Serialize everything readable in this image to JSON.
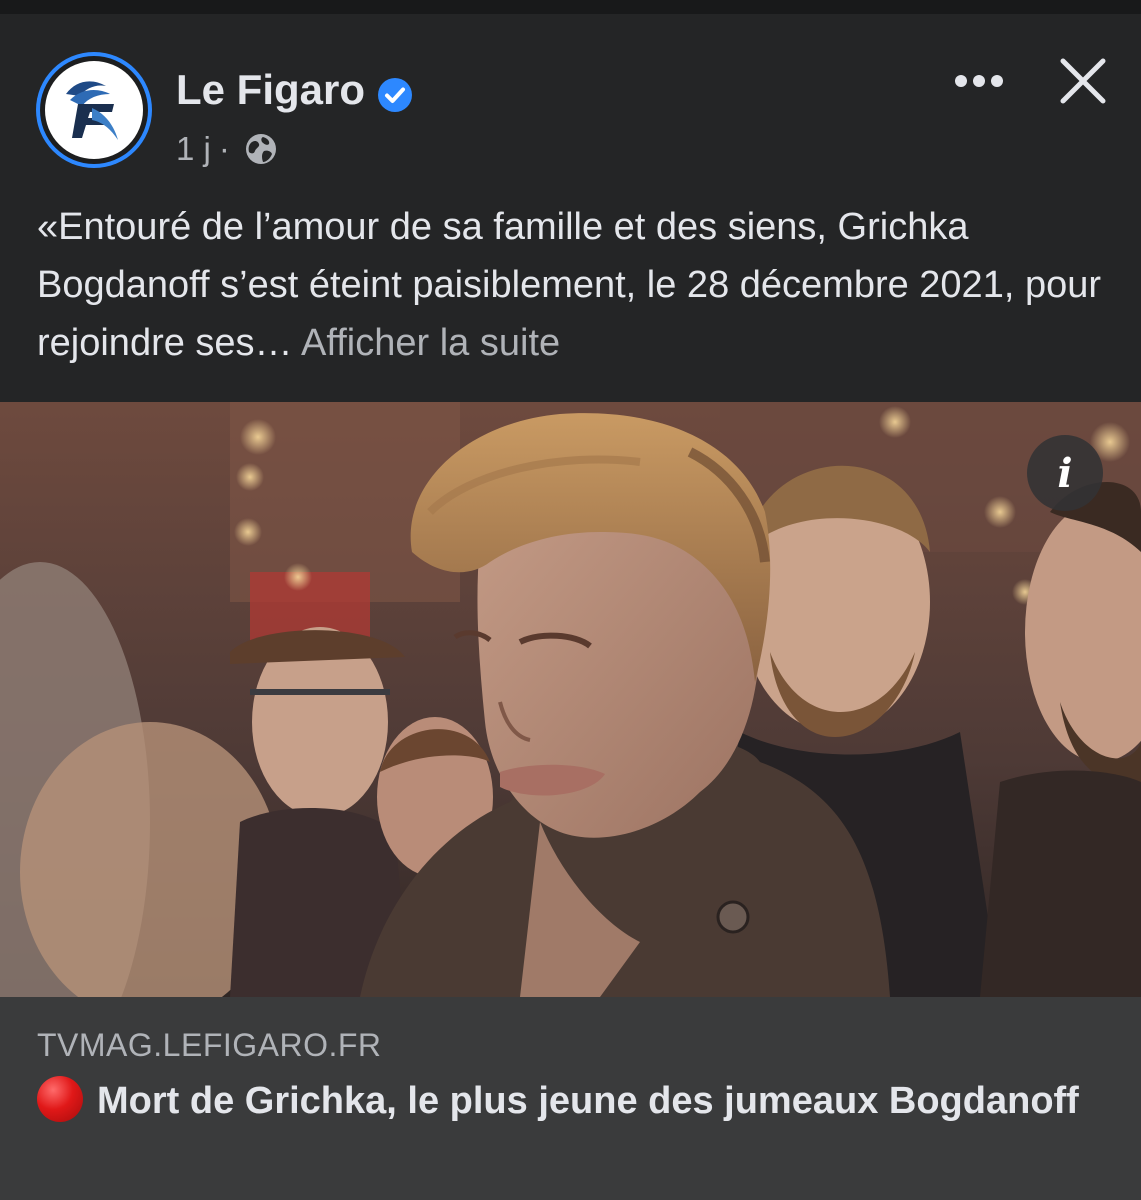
{
  "post": {
    "author": "Le Figaro",
    "avatar_icon": "le-figaro-logo",
    "verified_icon": "verified-badge-icon",
    "timestamp": "1 j",
    "separator": "·",
    "audience_icon": "globe-icon",
    "text": "«Entouré de l’amour de sa famille et des siens, Grichka Bogdanoff s’est éteint paisiblement, le 28 décembre 2021, pour rejoindre ses…",
    "see_more": "Afficher la suite",
    "more_icon": "more-options-icon",
    "close_icon": "close-icon"
  },
  "media": {
    "info_icon": "info-icon",
    "info_label": "i"
  },
  "link": {
    "domain": "TVMAG.LEFIGARO.FR",
    "title_icon": "red-circle-icon",
    "title": "Mort de Grichka, le plus jeune des jumeaux Bogdanoff"
  },
  "colors": {
    "background": "#242526",
    "link_background": "#3a3b3c",
    "verified": "#2d88ff",
    "primary_text": "#e4e6eb",
    "secondary_text": "#b0b3b8"
  }
}
